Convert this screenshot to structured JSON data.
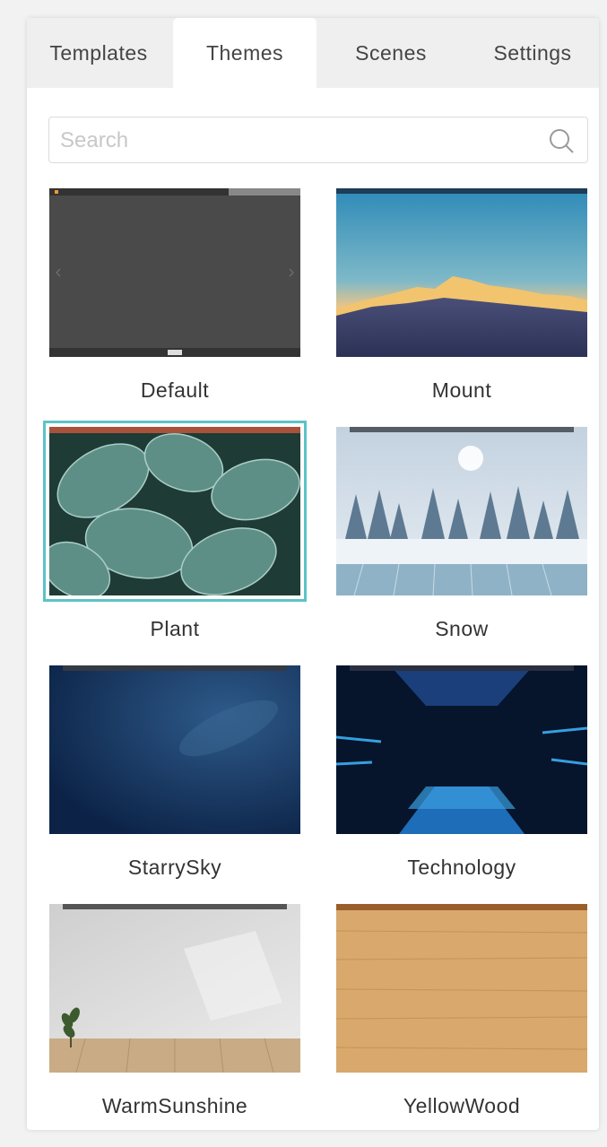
{
  "tabs": [
    {
      "label": "Templates"
    },
    {
      "label": "Themes"
    },
    {
      "label": "Scenes"
    },
    {
      "label": "Settings"
    }
  ],
  "active_tab": "Themes",
  "search": {
    "placeholder": "Search",
    "value": ""
  },
  "themes": [
    {
      "name": "Default"
    },
    {
      "name": "Mount"
    },
    {
      "name": "Plant"
    },
    {
      "name": "Snow"
    },
    {
      "name": "StarrySky"
    },
    {
      "name": "Technology"
    },
    {
      "name": "WarmSunshine"
    },
    {
      "name": "YellowWood"
    }
  ],
  "selected_theme": "Plant",
  "colors": {
    "accent": "#5cc3c7",
    "tab_bar": "#efefef",
    "panel": "#ffffff"
  }
}
